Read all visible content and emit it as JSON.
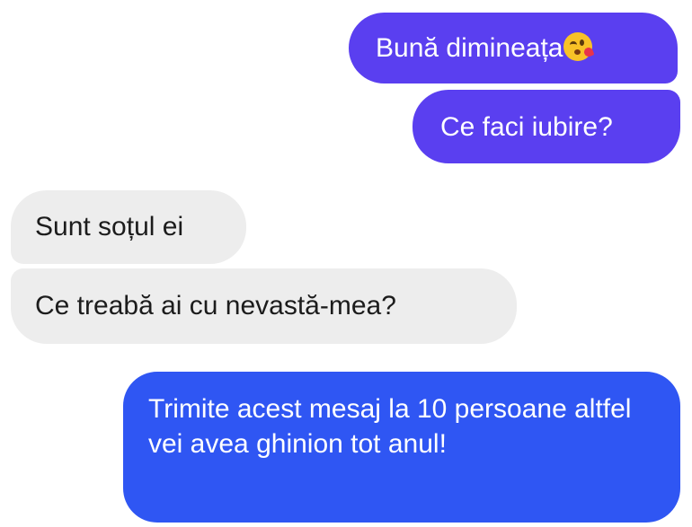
{
  "messages": [
    {
      "id": "m1",
      "side": "sent",
      "text": "Bună dimineața",
      "emoji": "face-blowing-a-kiss-icon"
    },
    {
      "id": "m2",
      "side": "sent",
      "text": "Ce faci iubire?"
    },
    {
      "id": "m3",
      "side": "received",
      "text": "Sunt soțul ei"
    },
    {
      "id": "m4",
      "side": "received",
      "text": "Ce treabă ai cu nevastă-mea?"
    },
    {
      "id": "m5",
      "side": "sent",
      "text": "Trimite acest mesaj la 10 persoane altfel vei avea ghinion tot anul!"
    }
  ],
  "colors": {
    "sent_purple": "#5a3ff0",
    "sent_blue": "#2f56f3",
    "received_bg": "#ededed",
    "received_text": "#1c1c1c",
    "sent_text": "#ffffff"
  }
}
